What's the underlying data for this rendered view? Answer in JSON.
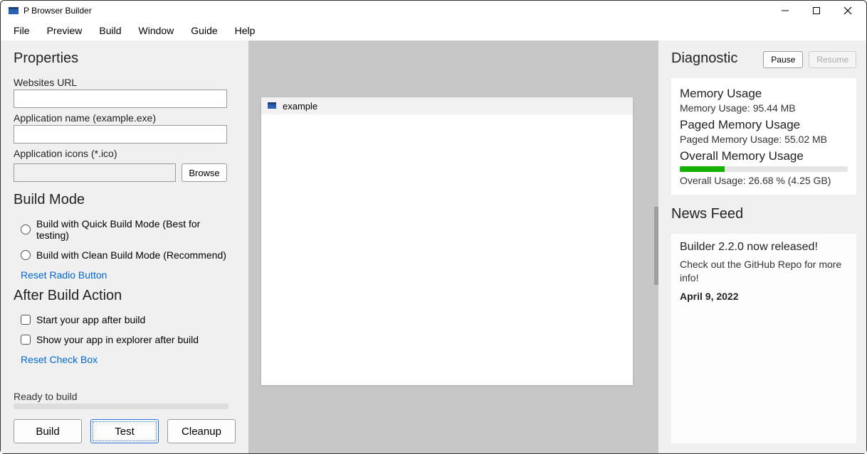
{
  "window": {
    "title": "P Browser Builder"
  },
  "menu": {
    "items": [
      "File",
      "Preview",
      "Build",
      "Window",
      "Guide",
      "Help"
    ]
  },
  "left": {
    "properties_head": "Properties",
    "url_label": "Websites URL",
    "url_value": "",
    "appname_label": "Application name (example.exe)",
    "appname_value": "",
    "icons_label": "Application icons (*.ico)",
    "icons_value": "",
    "browse_label": "Browse",
    "build_mode_head": "Build Mode",
    "radio_quick": "Build with Quick Build Mode (Best for testing)",
    "radio_clean": "Build with Clean Build Mode (Recommend)",
    "reset_radio": "Reset Radio Button",
    "after_build_head": "After Build Action",
    "check_start": "Start your app after build",
    "check_show": "Show your app in explorer after build",
    "reset_check": "Reset Check Box",
    "status": "Ready to build",
    "build_btn": "Build",
    "test_btn": "Test",
    "cleanup_btn": "Cleanup"
  },
  "center": {
    "preview_title": "example"
  },
  "right": {
    "diag_head": "Diagnostic",
    "pause": "Pause",
    "resume": "Resume",
    "mem_head": "Memory Usage",
    "mem_val": "Memory Usage: 95.44 MB",
    "paged_head": "Paged Memory Usage",
    "paged_val": "Paged Memory Usage: 55.02 MB",
    "overall_head": "Overall Memory Usage",
    "overall_pct": 26.68,
    "overall_val": "Overall Usage: 26.68 % (4.25 GB)",
    "news_head": "News Feed",
    "news_title": "Builder 2.2.0 now released!",
    "news_body": "Check out the GitHub Repo for more info!",
    "news_date": "April 9, 2022"
  }
}
